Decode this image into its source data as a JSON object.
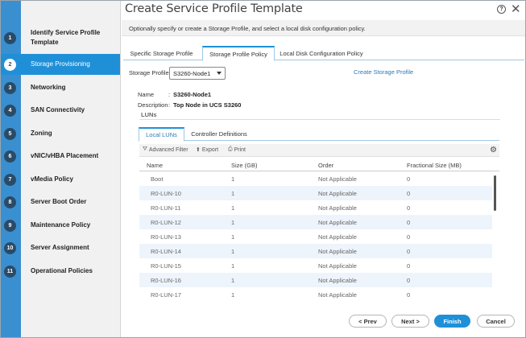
{
  "title": "Create Service Profile Template",
  "subtitle": "Optionally specify or create a Storage Profile, and select a local disk configuration policy.",
  "steps": [
    {
      "num": "1",
      "label": "Identify Service Profile Template"
    },
    {
      "num": "2",
      "label": "Storage Provisioning"
    },
    {
      "num": "3",
      "label": "Networking"
    },
    {
      "num": "4",
      "label": "SAN Connectivity"
    },
    {
      "num": "5",
      "label": "Zoning"
    },
    {
      "num": "6",
      "label": "vNIC/vHBA Placement"
    },
    {
      "num": "7",
      "label": "vMedia Policy"
    },
    {
      "num": "8",
      "label": "Server Boot Order"
    },
    {
      "num": "9",
      "label": "Maintenance Policy"
    },
    {
      "num": "10",
      "label": "Server Assignment"
    },
    {
      "num": "11",
      "label": "Operational Policies"
    }
  ],
  "tabs": [
    "Specific Storage Profile",
    "Storage Profile Policy",
    "Local Disk Configuration Policy"
  ],
  "storage_profile": {
    "label": "Storage Profile:",
    "selected": "S3260-Node1",
    "create_link": "Create Storage Profile",
    "name_label": "Name",
    "name_value": "S3260-Node1",
    "desc_label": "Description",
    "desc_value": "Top Node in UCS S3260",
    "luns_label": "LUNs"
  },
  "subtabs": [
    "Local LUNs",
    "Controller Definitions"
  ],
  "toolbar": {
    "filter": "Advanced Filter",
    "export": "Export",
    "print": "Print"
  },
  "table": {
    "columns": [
      "Name",
      "Size (GB)",
      "Order",
      "Fractional Size (MB)"
    ],
    "rows": [
      [
        "Boot",
        "1",
        "Not Applicable",
        "0"
      ],
      [
        "R0-LUN-10",
        "1",
        "Not Applicable",
        "0"
      ],
      [
        "R0-LUN-11",
        "1",
        "Not Applicable",
        "0"
      ],
      [
        "R0-LUN-12",
        "1",
        "Not Applicable",
        "0"
      ],
      [
        "R0-LUN-13",
        "1",
        "Not Applicable",
        "0"
      ],
      [
        "R0-LUN-14",
        "1",
        "Not Applicable",
        "0"
      ],
      [
        "R0-LUN-15",
        "1",
        "Not Applicable",
        "0"
      ],
      [
        "R0-LUN-16",
        "1",
        "Not Applicable",
        "0"
      ],
      [
        "R0-LUN-17",
        "1",
        "Not Applicable",
        "0"
      ]
    ]
  },
  "footer": {
    "prev": "< Prev",
    "next": "Next >",
    "finish": "Finish",
    "cancel": "Cancel"
  },
  "colors": {
    "accent": "#1f90d8",
    "rail": "#3a8fd0",
    "step_badge": "#2a4b67",
    "link": "#2a7ab9"
  }
}
